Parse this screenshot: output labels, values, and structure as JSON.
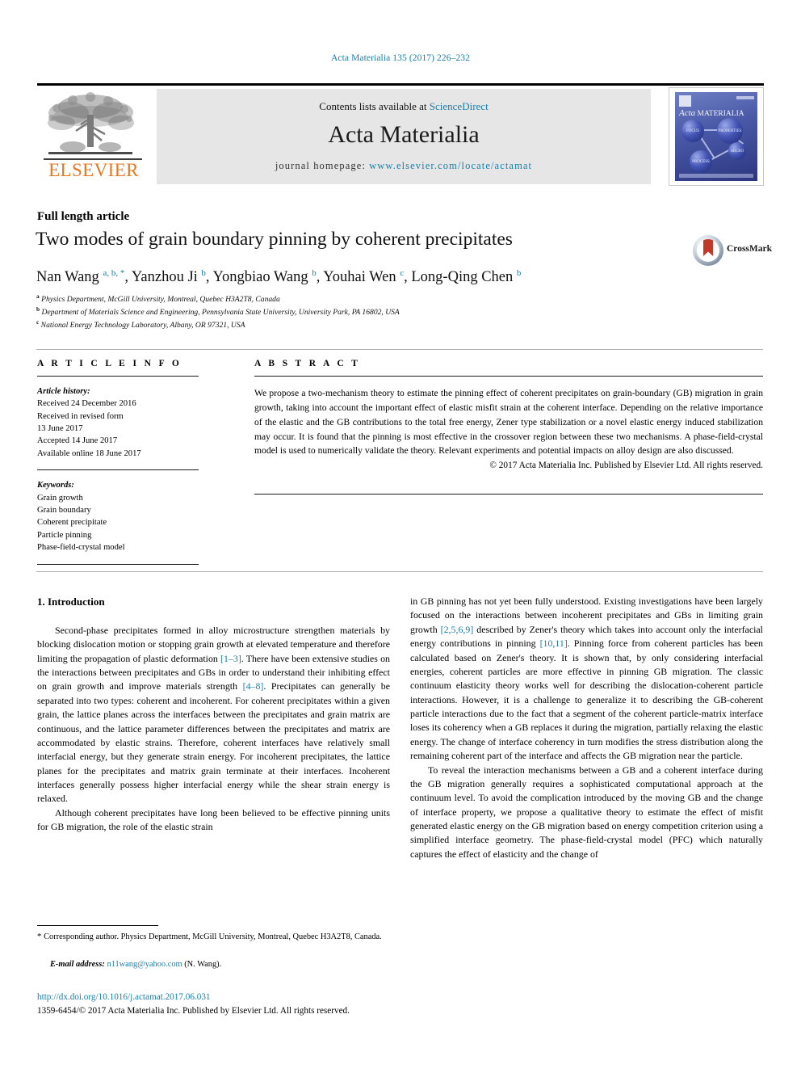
{
  "running_head": "Acta Materialia 135 (2017) 226–232",
  "masthead": {
    "contents_prefix": "Contents lists available at ",
    "sciencedirect": "ScienceDirect",
    "journal_title": "Acta Materialia",
    "homepage_label": "journal homepage: ",
    "homepage_url": "www.elsevier.com/locate/actamat",
    "publisher_wordmark": "ELSEVIER",
    "cover": {
      "journal_name_italic": "Acta",
      "journal_name_caps": "MATERIALIA",
      "nodes": [
        "FOCUS",
        "PROPERTIES",
        "MICRO",
        "PROCESS"
      ]
    }
  },
  "article": {
    "type": "Full length article",
    "title": "Two modes of grain boundary pinning by coherent precipitates",
    "crossmark_label": "CrossMark",
    "authors_html": "Nan Wang <sup>a, b, *</sup>, Yanzhou Ji <sup>b</sup>, Yongbiao Wang <sup>b</sup>, Youhai Wen <sup>c</sup>, Long-Qing Chen <sup>b</sup>",
    "affiliations": [
      {
        "marker": "a",
        "text": "Physics Department, McGill University, Montreal, Quebec H3A2T8, Canada"
      },
      {
        "marker": "b",
        "text": "Department of Materials Science and Engineering, Pennsylvania State University, University Park, PA 16802, USA"
      },
      {
        "marker": "c",
        "text": "National Energy Technology Laboratory, Albany, OR 97321, USA"
      }
    ]
  },
  "article_info": {
    "heading": "A R T I C L E   I N F O",
    "history_label": "Article history:",
    "history": [
      "Received 24 December 2016",
      "Received in revised form",
      "13 June 2017",
      "Accepted 14 June 2017",
      "Available online 18 June 2017"
    ],
    "keywords_label": "Keywords:",
    "keywords": [
      "Grain growth",
      "Grain boundary",
      "Coherent precipitate",
      "Particle pinning",
      "Phase-field-crystal model"
    ]
  },
  "abstract": {
    "heading": "A B S T R A C T",
    "text": "We propose a two-mechanism theory to estimate the pinning effect of coherent precipitates on grain-boundary (GB) migration in grain growth, taking into account the important effect of elastic misfit strain at the coherent interface. Depending on the relative importance of the elastic and the GB contributions to the total free energy, Zener type stabilization or a novel elastic energy induced stabilization may occur. It is found that the pinning is most effective in the crossover region between these two mechanisms. A phase-field-crystal model is used to numerically validate the theory. Relevant experiments and potential impacts on alloy design are also discussed.",
    "copyright": "© 2017 Acta Materialia Inc. Published by Elsevier Ltd. All rights reserved."
  },
  "body": {
    "section_heading": "1. Introduction",
    "left_paragraphs": [
      "Second-phase precipitates formed in alloy microstructure strengthen materials by blocking dislocation motion or stopping grain growth at elevated temperature and therefore limiting the propagation of plastic deformation [1–3]. There have been extensive studies on the interactions between precipitates and GBs in order to understand their inhibiting effect on grain growth and improve materials strength [4–8]. Precipitates can generally be separated into two types: coherent and incoherent. For coherent precipitates within a given grain, the lattice planes across the interfaces between the precipitates and grain matrix are continuous, and the lattice parameter differences between the precipitates and matrix are accommodated by elastic strains. Therefore, coherent interfaces have relatively small interfacial energy, but they generate strain energy. For incoherent precipitates, the lattice planes for the precipitates and matrix grain terminate at their interfaces. Incoherent interfaces generally possess higher interfacial energy while the shear strain energy is relaxed.",
      "Although coherent precipitates have long been believed to be effective pinning units for GB migration, the role of the elastic strain"
    ],
    "right_paragraphs": [
      "in GB pinning has not yet been fully understood. Existing investigations have been largely focused on the interactions between incoherent precipitates and GBs in limiting grain growth [2,5,6,9] described by Zener's theory which takes into account only the interfacial energy contributions in pinning [10,11]. Pinning force from coherent particles has been calculated based on Zener's theory. It is shown that, by only considering interfacial energies, coherent particles are more effective in pinning GB migration. The classic continuum elasticity theory works well for describing the dislocation-coherent particle interactions. However, it is a challenge to generalize it to describing the GB-coherent particle interactions due to the fact that a segment of the coherent particle-matrix interface loses its coherency when a GB replaces it during the migration, partially relaxing the elastic energy. The change of interface coherency in turn modifies the stress distribution along the remaining coherent part of the interface and affects the GB migration near the particle.",
      "To reveal the interaction mechanisms between a GB and a coherent interface during the GB migration generally requires a sophisticated computational approach at the continuum level. To avoid the complication introduced by the moving GB and the change of interface property, we propose a qualitative theory to estimate the effect of misfit generated elastic energy on the GB migration based on energy competition criterion using a simplified interface geometry. The phase-field-crystal model (PFC) which naturally captures the effect of elasticity and the change of"
    ],
    "reference_marks": [
      "[1–3]",
      "[4–8]",
      "[2,5,6,9]",
      "[10,11]"
    ]
  },
  "footer": {
    "corresponding_star": "*",
    "corresponding_text": "Corresponding author. Physics Department, McGill University, Montreal, Quebec H3A2T8, Canada.",
    "email_label": "E-mail address:",
    "email": "n11wang@yahoo.com",
    "email_suffix": "(N. Wang).",
    "doi": "http://dx.doi.org/10.1016/j.actamat.2017.06.031",
    "issn_line": "1359-6454/© 2017 Acta Materialia Inc. Published by Elsevier Ltd. All rights reserved."
  },
  "colors": {
    "link": "#1a7fa8",
    "elsevier_orange": "#e87722",
    "band": "#e6e6e6"
  }
}
